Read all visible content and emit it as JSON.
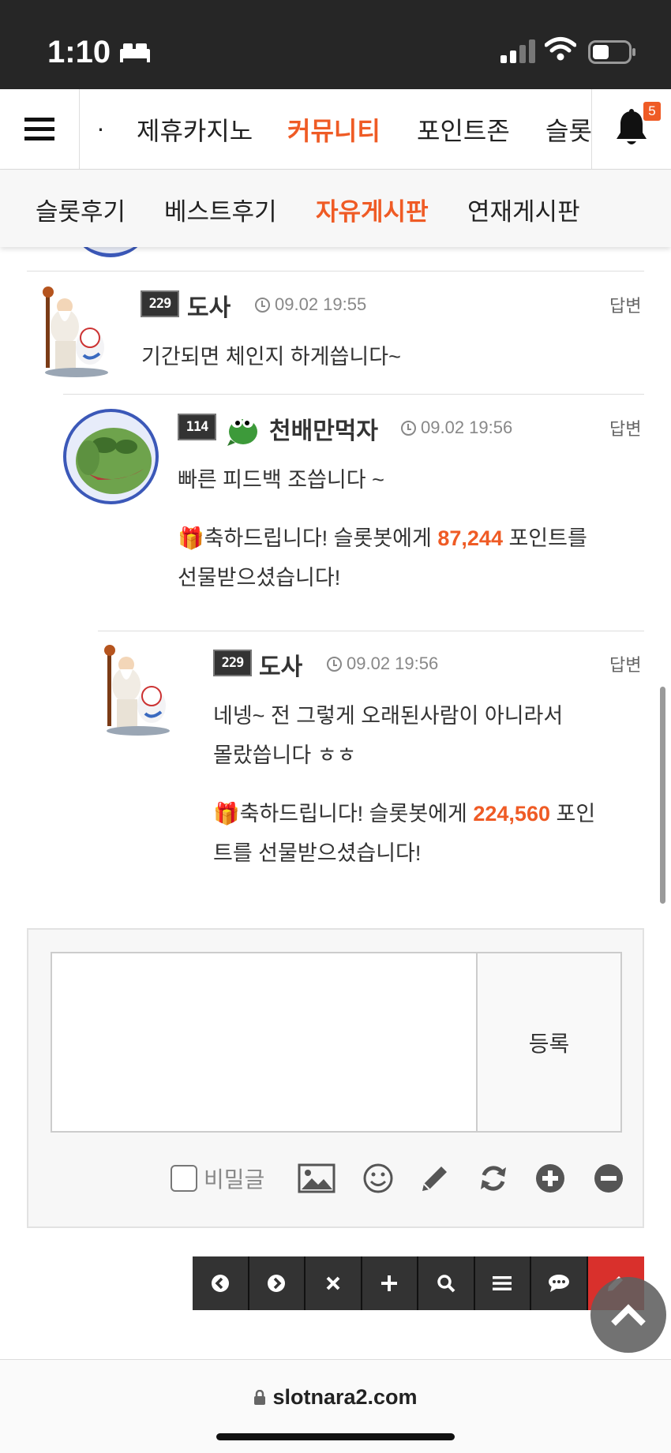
{
  "status_bar": {
    "time": "1:10"
  },
  "main_nav": {
    "tabs": [
      {
        "label": "제휴카지노",
        "active": false
      },
      {
        "label": "커뮤니티",
        "active": true
      },
      {
        "label": "포인트존",
        "active": false
      },
      {
        "label": "슬롯",
        "active": false
      }
    ],
    "notification_count": "5"
  },
  "sub_nav": {
    "tabs": [
      {
        "label": "슬롯후기",
        "active": false
      },
      {
        "label": "베스트후기",
        "active": false
      },
      {
        "label": "자유게시판",
        "active": true
      },
      {
        "label": "연재게시판",
        "active": false
      }
    ]
  },
  "comments": [
    {
      "level": "229",
      "nickname": "도사",
      "time": "09.02 19:55",
      "reply_label": "답변",
      "lines": [
        "기간되면 체인지 하게씁니다~"
      ],
      "gift": null
    },
    {
      "level": "114",
      "nickname": "천배만먹자",
      "time": "09.02 19:56",
      "reply_label": "답변",
      "lines": [
        "빠른 피드백 조씁니다 ~"
      ],
      "gift": {
        "prefix": "축하드립니다! 슬롯봇에게 ",
        "points": "87,244",
        "suffix_line1": " 포인트를",
        "line2": "선물받으셨습니다!"
      }
    },
    {
      "level": "229",
      "nickname": "도사",
      "time": "09.02 19:56",
      "reply_label": "답변",
      "lines": [
        "네넹~ 전 그렇게 오래된사람이 아니라서",
        "몰랐씁니다 ㅎㅎ"
      ],
      "gift": {
        "prefix": "축하드립니다! 슬롯봇에게 ",
        "points": "224,560",
        "suffix_line1": " 포인",
        "line2": "트를 선물받으셨습니다!"
      }
    }
  ],
  "comment_form": {
    "submit_label": "등록",
    "secret_label": "비밀글",
    "tools": [
      "image-icon",
      "smile-icon",
      "pencil-icon",
      "refresh-icon",
      "plus-circle-icon",
      "minus-circle-icon"
    ]
  },
  "toolbar": {
    "buttons": [
      "chevron-left-icon",
      "chevron-right-icon",
      "close-icon",
      "plus-icon",
      "search-icon",
      "list-icon",
      "comment-icon",
      "write-icon"
    ]
  },
  "url_bar": {
    "domain": "slotnara2.com"
  },
  "colors": {
    "accent": "#ef5b25",
    "toolbar": "#333333",
    "write_button": "#d9302c"
  }
}
